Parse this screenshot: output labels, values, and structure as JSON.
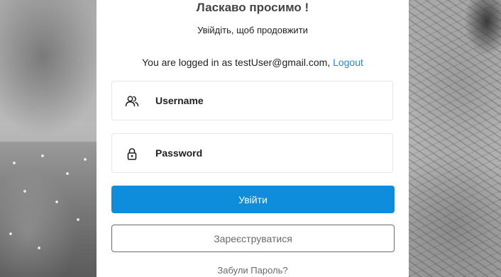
{
  "header": {
    "title": "Ласкаво просимо !",
    "subtitle": "Увійдіть, щоб продовжити"
  },
  "session": {
    "prefix": "You are logged in as testUser@gmail.com, ",
    "logout_label": "Logout"
  },
  "form": {
    "username_label": "Username",
    "username_icon": "users-icon",
    "password_label": "Password",
    "password_icon": "lock-icon",
    "login_label": "Увійти",
    "register_label": "Зареєструватися",
    "forgot_label": "Забули Пароль?"
  },
  "colors": {
    "accent": "#0d8ddb",
    "link": "#1a8fd8",
    "muted_text": "#6a6a6a"
  }
}
